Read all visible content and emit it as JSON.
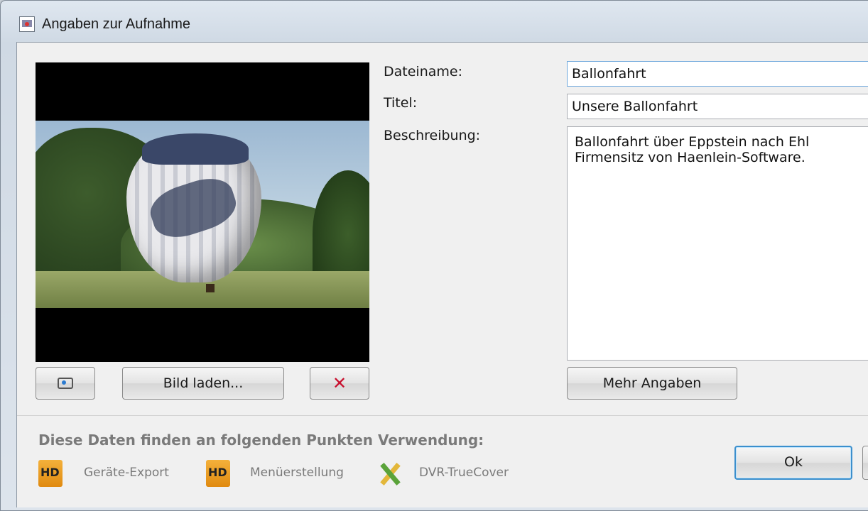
{
  "window": {
    "title": "Angaben zur Aufnahme"
  },
  "preview": {
    "load_image_label": "Bild laden...",
    "delete_label": "✕"
  },
  "form": {
    "filename_label": "Dateiname:",
    "filename_value": "Ballonfahrt",
    "title_label": "Titel:",
    "title_value": "Unsere Ballonfahrt",
    "description_label": "Beschreibung:",
    "description_lines": [
      "Ballonfahrt über Eppstein nach Ehl",
      "Firmensitz von Haenlein-Software."
    ],
    "more_button": "Mehr Angaben"
  },
  "footer": {
    "usage_heading": "Diese Daten finden an folgenden Punkten Verwendung:",
    "usage_items": [
      {
        "label": "Geräte-Export",
        "icon": "hd-icon"
      },
      {
        "label": "Menüerstellung",
        "icon": "hd-icon"
      },
      {
        "label": "DVR-TrueCover",
        "icon": "pencil-ruler-icon"
      }
    ],
    "ok_button": "Ok"
  },
  "colors": {
    "accent": "#3b8fcd",
    "delete": "#c8102e",
    "muted_text": "#7a7a7a"
  }
}
